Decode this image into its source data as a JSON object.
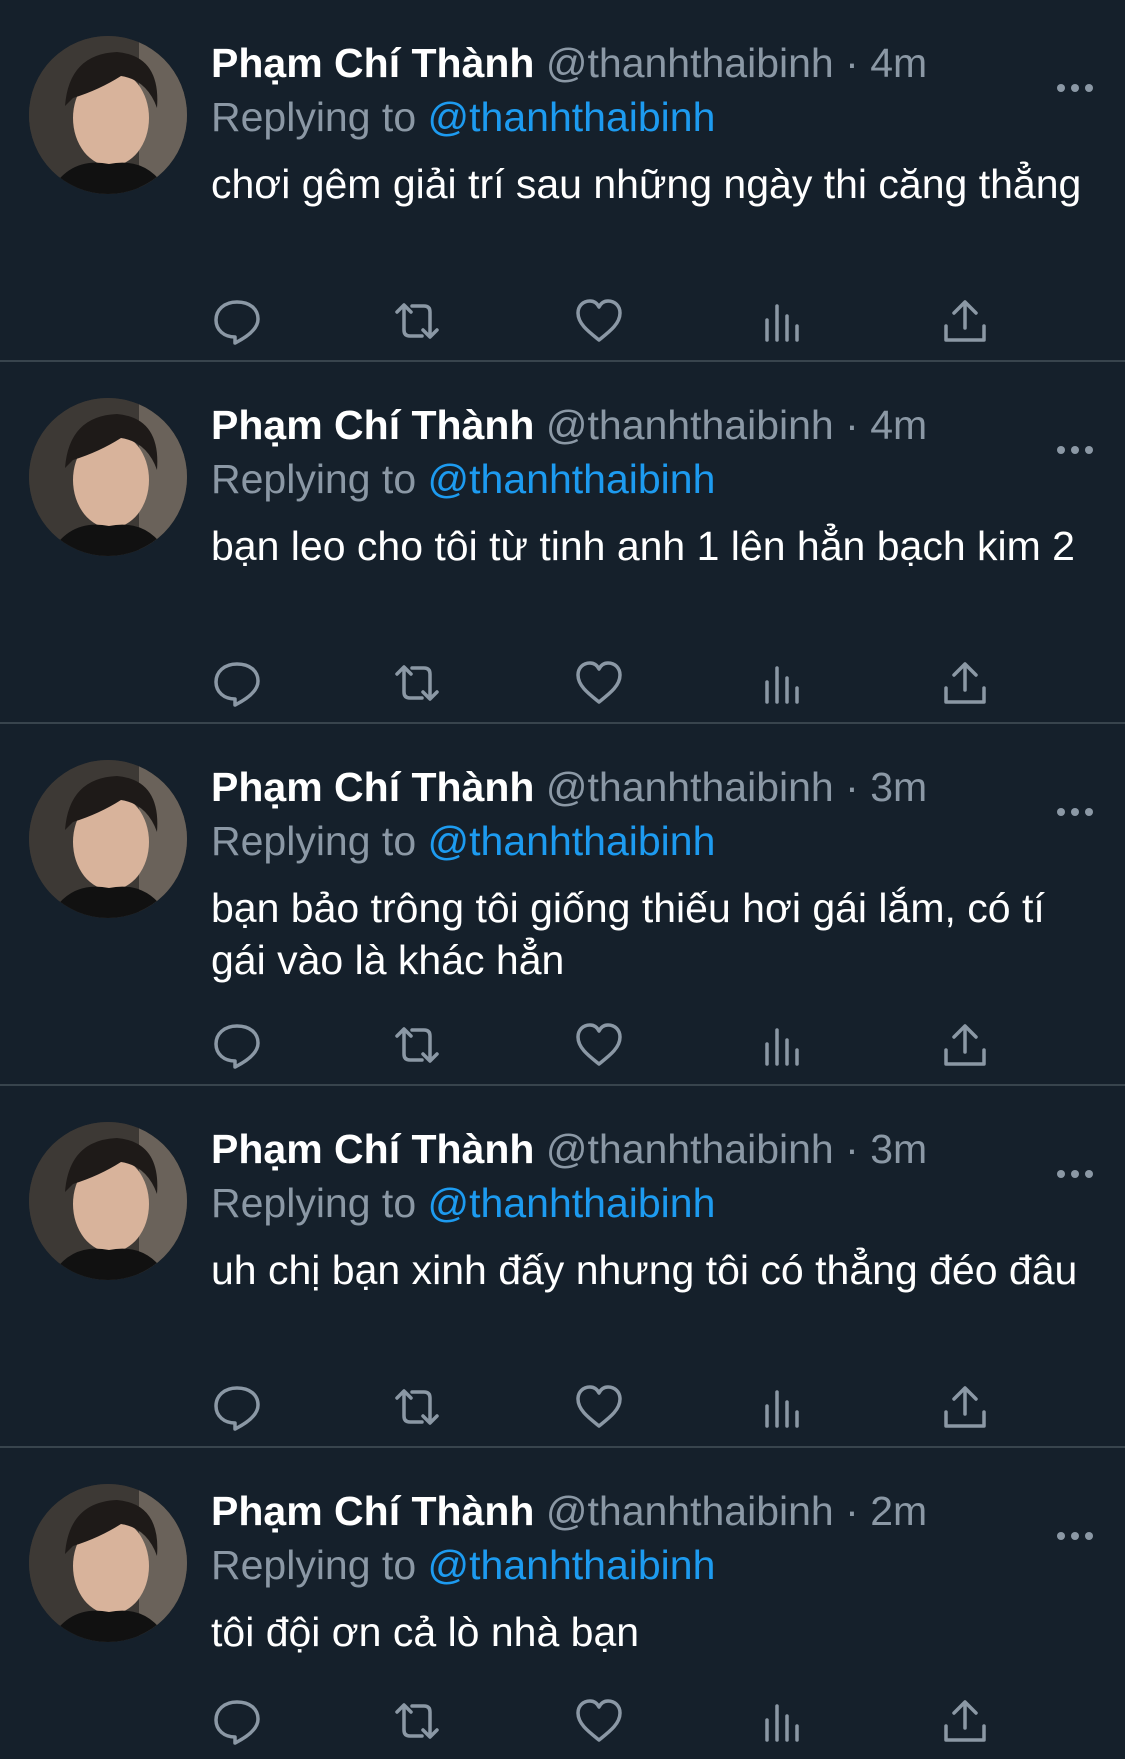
{
  "tweets": [
    {
      "display_name": "Phạm Chí Thành",
      "handle": "@thanhthaibinh",
      "separator": "·",
      "time": "4m",
      "replying_prefix": "Replying to",
      "replying_handle": "@thanhthaibinh",
      "text": "chơi gêm giải trí sau những ngày thi căng thẳng"
    },
    {
      "display_name": "Phạm Chí Thành",
      "handle": "@thanhthaibinh",
      "separator": "·",
      "time": "4m",
      "replying_prefix": "Replying to",
      "replying_handle": "@thanhthaibinh",
      "text": "bạn leo cho tôi từ tinh anh 1 lên hẳn bạch kim 2"
    },
    {
      "display_name": "Phạm Chí Thành",
      "handle": "@thanhthaibinh",
      "separator": "·",
      "time": "3m",
      "replying_prefix": "Replying to",
      "replying_handle": "@thanhthaibinh",
      "text": "bạn bảo trông tôi giống thiếu hơi gái lắm, có tí gái vào là khác hẳn"
    },
    {
      "display_name": "Phạm Chí Thành",
      "handle": "@thanhthaibinh",
      "separator": "·",
      "time": "3m",
      "replying_prefix": "Replying to",
      "replying_handle": "@thanhthaibinh",
      "text": "uh chị bạn xinh đấy nhưng tôi có thẳng đéo đâu"
    },
    {
      "display_name": "Phạm Chí Thành",
      "handle": "@thanhthaibinh",
      "separator": "·",
      "time": "2m",
      "replying_prefix": "Replying to",
      "replying_handle": "@thanhthaibinh",
      "text": "tôi đội ơn cả lò nhà bạn"
    }
  ],
  "icons": {
    "more": "more-horizontal-icon",
    "reply": "reply-bubble-icon",
    "retweet": "retweet-icon",
    "like": "heart-icon",
    "views": "bar-chart-icon",
    "share": "share-upload-icon"
  },
  "colors": {
    "background": "#15202b",
    "divider": "#38444d",
    "primary_text": "#ffffff",
    "secondary_text": "#8b98a5",
    "link": "#1d9bf0"
  }
}
